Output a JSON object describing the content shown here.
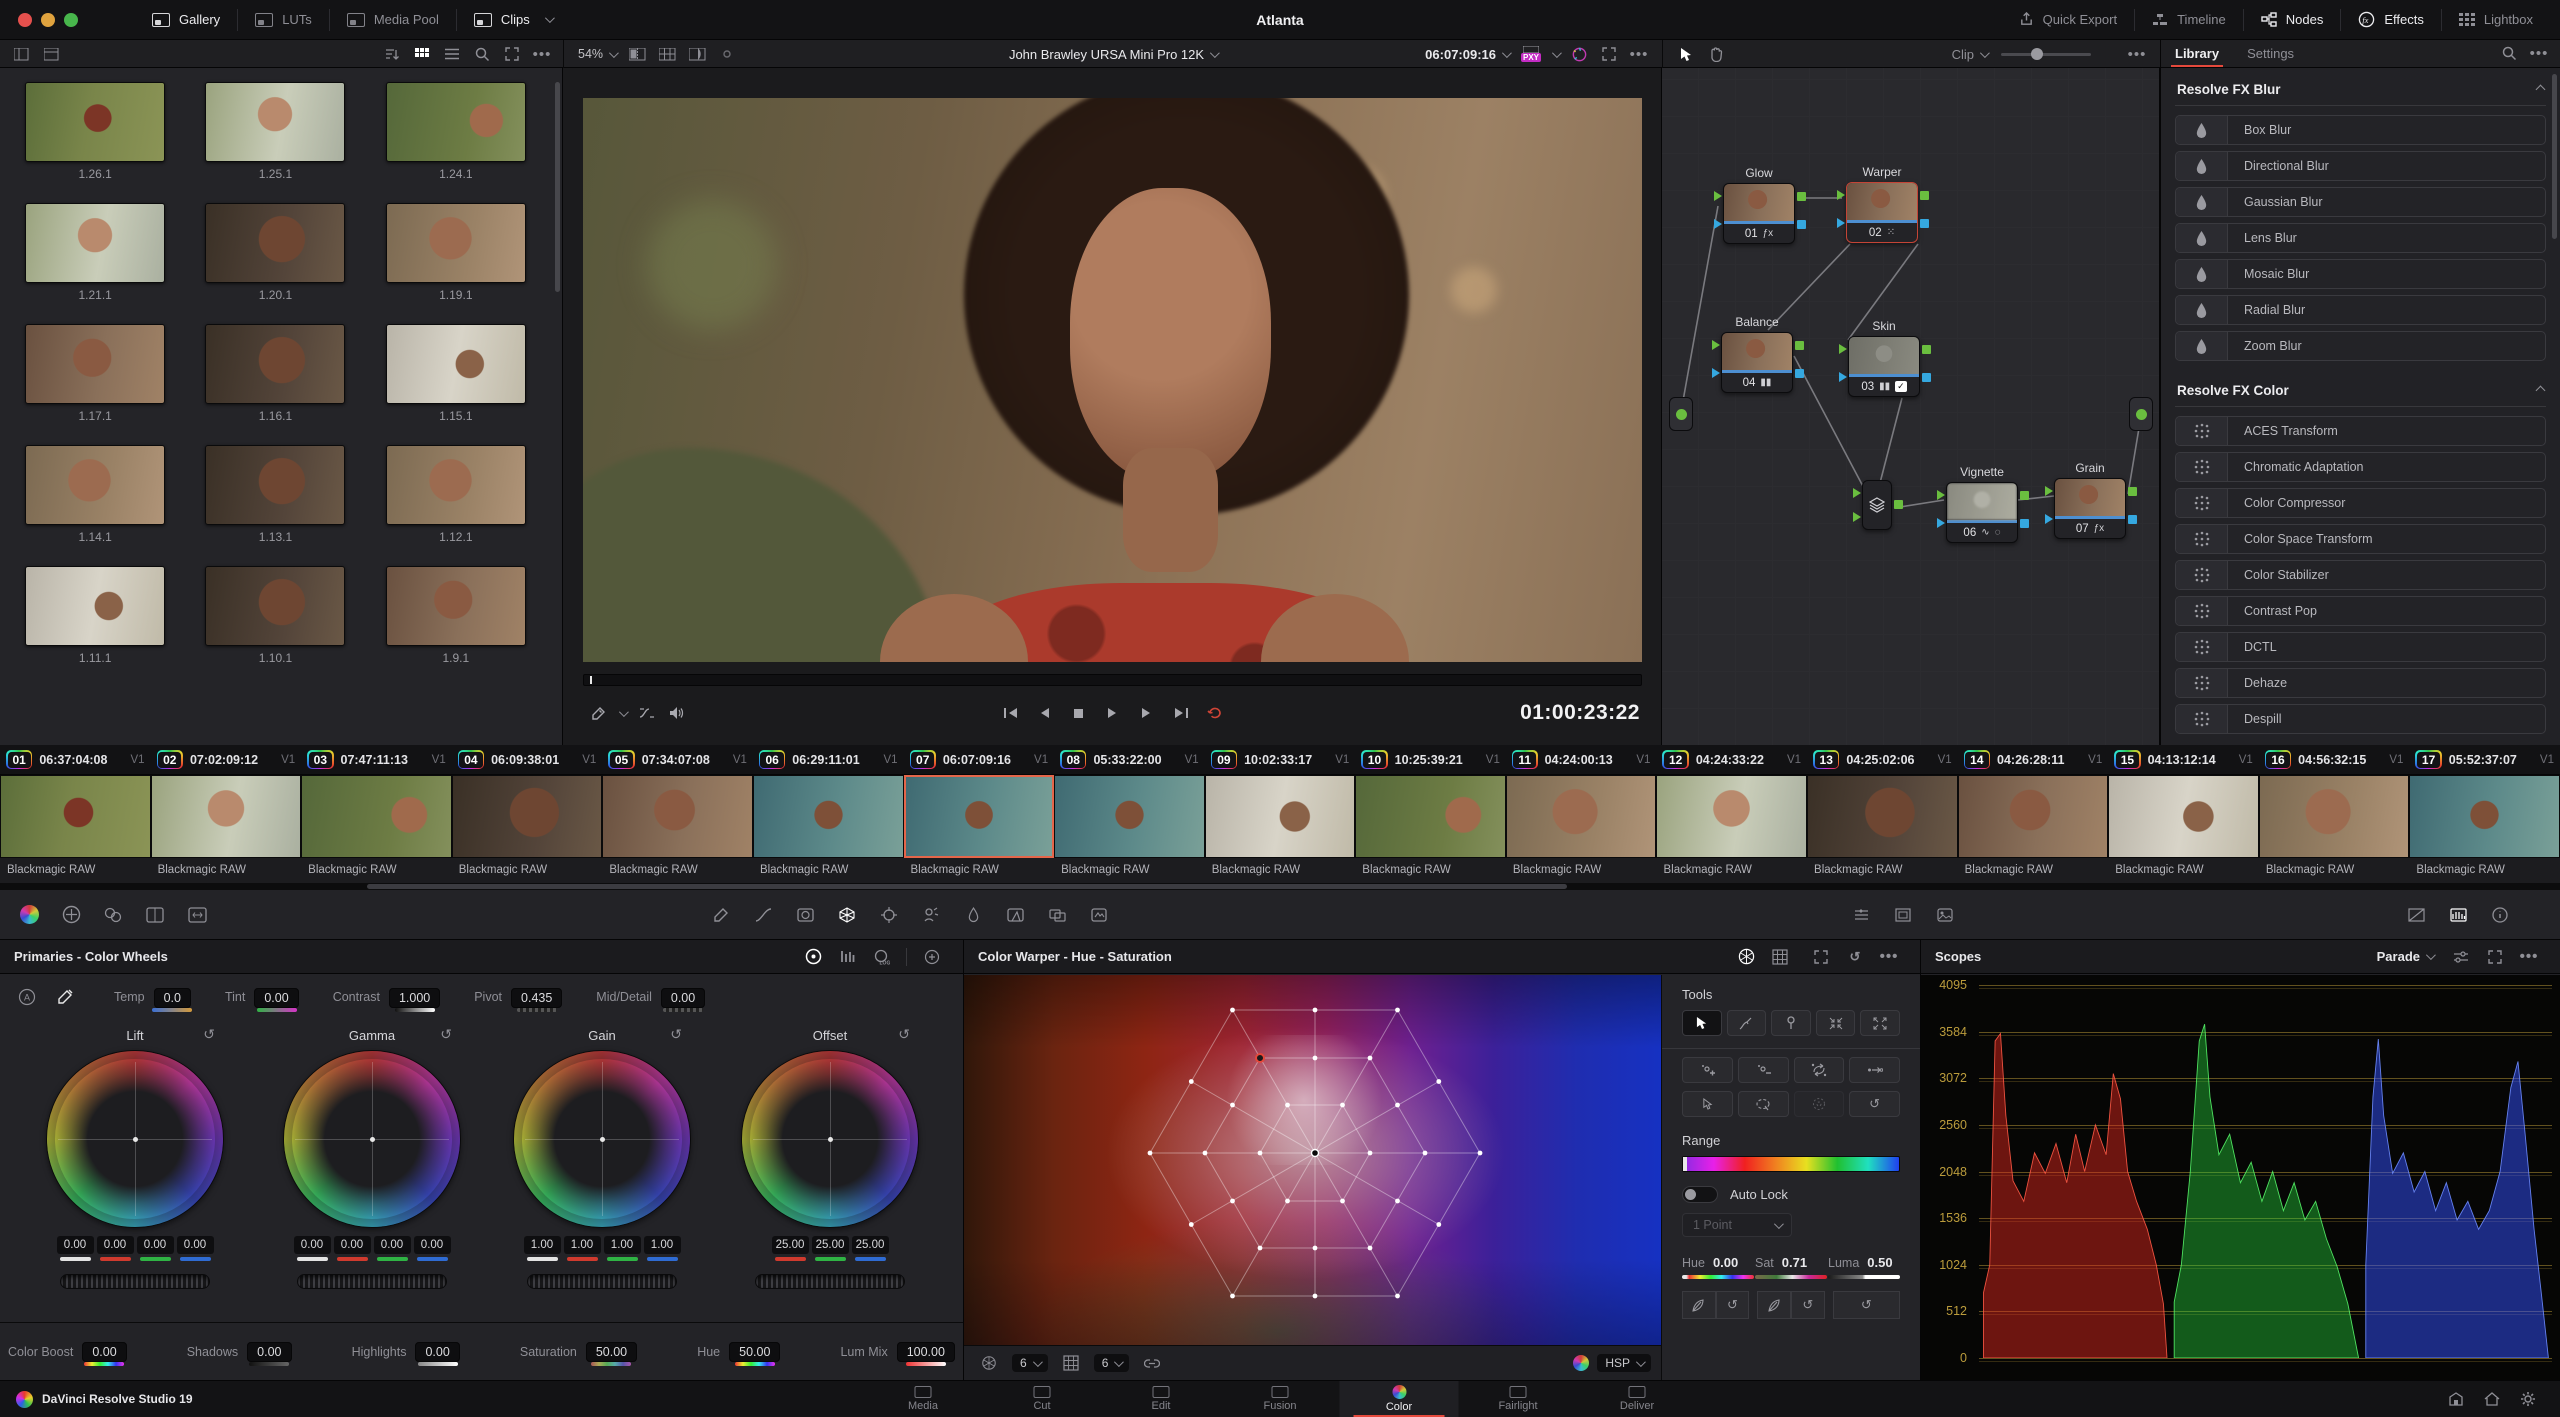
{
  "titlebar": {
    "title": "Atlanta",
    "left": [
      {
        "label": "Gallery",
        "active": true
      },
      {
        "label": "LUTs",
        "active": false
      },
      {
        "label": "Media Pool",
        "active": false
      },
      {
        "label": "Clips",
        "active": true,
        "dropdown": true
      }
    ],
    "right": [
      {
        "label": "Quick Export",
        "active": false
      },
      {
        "label": "Timeline",
        "active": false
      },
      {
        "label": "Nodes",
        "active": true
      },
      {
        "label": "Effects",
        "active": true
      },
      {
        "label": "Lightbox",
        "active": false
      }
    ]
  },
  "gallery": {
    "zoom_level": "54%",
    "stills": [
      "1.26.1",
      "1.25.1",
      "1.24.1",
      "1.21.1",
      "1.20.1",
      "1.19.1",
      "1.17.1",
      "1.16.1",
      "1.15.1",
      "1.14.1",
      "1.13.1",
      "1.12.1",
      "1.11.1",
      "1.10.1",
      "1.9.1"
    ]
  },
  "viewer": {
    "clip_title": "John Brawley URSA Mini Pro 12K",
    "timecode": "06:07:09:16",
    "proxy_badge": "PXY",
    "play_timecode": "01:00:23:22"
  },
  "node_panel": {
    "mode_label": "Clip",
    "nodes": {
      "glow": {
        "num": "01",
        "label": "Glow"
      },
      "warper": {
        "num": "02",
        "label": "Warper"
      },
      "balance": {
        "num": "04",
        "label": "Balance"
      },
      "skin": {
        "num": "03",
        "label": "Skin"
      },
      "vignette": {
        "num": "06",
        "label": "Vignette"
      },
      "grain": {
        "num": "07",
        "label": "Grain"
      }
    }
  },
  "library": {
    "tabs": [
      {
        "label": "Library",
        "active": true
      },
      {
        "label": "Settings",
        "active": false
      }
    ],
    "sections": [
      {
        "title": "Resolve FX Blur",
        "items": [
          "Box Blur",
          "Directional Blur",
          "Gaussian Blur",
          "Lens Blur",
          "Mosaic Blur",
          "Radial Blur",
          "Zoom Blur"
        ]
      },
      {
        "title": "Resolve FX Color",
        "items": [
          "ACES Transform",
          "Chromatic Adaptation",
          "Color Compressor",
          "Color Space Transform",
          "Color Stabilizer",
          "Contrast Pop",
          "DCTL",
          "Dehaze",
          "Despill"
        ]
      }
    ]
  },
  "timeline": {
    "clips": [
      {
        "num": "01",
        "timecode": "06:37:04:08",
        "track": "V1",
        "codec": "Blackmagic RAW",
        "selected": false
      },
      {
        "num": "02",
        "timecode": "07:02:09:12",
        "track": "V1",
        "codec": "Blackmagic RAW",
        "selected": false
      },
      {
        "num": "03",
        "timecode": "07:47:11:13",
        "track": "V1",
        "codec": "Blackmagic RAW",
        "selected": false
      },
      {
        "num": "04",
        "timecode": "06:09:38:01",
        "track": "V1",
        "codec": "Blackmagic RAW",
        "selected": false
      },
      {
        "num": "05",
        "timecode": "07:34:07:08",
        "track": "V1",
        "codec": "Blackmagic RAW",
        "selected": false
      },
      {
        "num": "06",
        "timecode": "06:29:11:01",
        "track": "V1",
        "codec": "Blackmagic RAW",
        "selected": false
      },
      {
        "num": "07",
        "timecode": "06:07:09:16",
        "track": "V1",
        "codec": "Blackmagic RAW",
        "selected": true
      },
      {
        "num": "08",
        "timecode": "05:33:22:00",
        "track": "V1",
        "codec": "Blackmagic RAW",
        "selected": false
      },
      {
        "num": "09",
        "timecode": "10:02:33:17",
        "track": "V1",
        "codec": "Blackmagic RAW",
        "selected": false
      },
      {
        "num": "10",
        "timecode": "10:25:39:21",
        "track": "V1",
        "codec": "Blackmagic RAW",
        "selected": false
      },
      {
        "num": "11",
        "timecode": "04:24:00:13",
        "track": "V1",
        "codec": "Blackmagic RAW",
        "selected": false
      },
      {
        "num": "12",
        "timecode": "04:24:33:22",
        "track": "V1",
        "codec": "Blackmagic RAW",
        "selected": false
      },
      {
        "num": "13",
        "timecode": "04:25:02:06",
        "track": "V1",
        "codec": "Blackmagic RAW",
        "selected": false
      },
      {
        "num": "14",
        "timecode": "04:26:28:11",
        "track": "V1",
        "codec": "Blackmagic RAW",
        "selected": false
      },
      {
        "num": "15",
        "timecode": "04:13:12:14",
        "track": "V1",
        "codec": "Blackmagic RAW",
        "selected": false
      },
      {
        "num": "16",
        "timecode": "04:56:32:15",
        "track": "V1",
        "codec": "Blackmagic RAW",
        "selected": false
      },
      {
        "num": "17",
        "timecode": "05:52:37:07",
        "track": "V1",
        "codec": "Blackmagic RAW",
        "selected": false
      }
    ]
  },
  "primaries": {
    "title": "Primaries - Color Wheels",
    "params": [
      {
        "label": "Temp",
        "value": "0.0"
      },
      {
        "label": "Tint",
        "value": "0.00"
      },
      {
        "label": "Contrast",
        "value": "1.000"
      },
      {
        "label": "Pivot",
        "value": "0.435"
      },
      {
        "label": "Mid/Detail",
        "value": "0.00"
      }
    ],
    "wheels": [
      {
        "name": "Lift",
        "values": [
          "0.00",
          "0.00",
          "0.00",
          "0.00"
        ]
      },
      {
        "name": "Gamma",
        "values": [
          "0.00",
          "0.00",
          "0.00",
          "0.00"
        ]
      },
      {
        "name": "Gain",
        "values": [
          "1.00",
          "1.00",
          "1.00",
          "1.00"
        ]
      },
      {
        "name": "Offset",
        "values": [
          "25.00",
          "25.00",
          "25.00"
        ]
      }
    ],
    "footer": [
      {
        "label": "Color Boost",
        "value": "0.00"
      },
      {
        "label": "Shadows",
        "value": "0.00"
      },
      {
        "label": "Highlights",
        "value": "0.00"
      },
      {
        "label": "Saturation",
        "value": "50.00"
      },
      {
        "label": "Hue",
        "value": "50.00"
      },
      {
        "label": "Lum Mix",
        "value": "100.00"
      }
    ]
  },
  "warper": {
    "title": "Color Warper - Hue - Saturation",
    "tools_label": "Tools",
    "range_label": "Range",
    "auto_lock_label": "Auto Lock",
    "point_mode": "1 Point",
    "params": [
      {
        "label": "Hue",
        "value": "0.00"
      },
      {
        "label": "Sat",
        "value": "0.71"
      },
      {
        "label": "Luma",
        "value": "0.50"
      }
    ],
    "grid_rows": "6",
    "grid_cols": "6",
    "color_mode": "HSP"
  },
  "scopes": {
    "title": "Scopes",
    "mode": "Parade",
    "ticks": [
      "4095",
      "3584",
      "3072",
      "2560",
      "2048",
      "1536",
      "1024",
      "512",
      "0"
    ]
  },
  "navbar": {
    "app_name": "DaVinci Resolve Studio 19",
    "pages": [
      {
        "label": "Media",
        "active": false
      },
      {
        "label": "Cut",
        "active": false
      },
      {
        "label": "Edit",
        "active": false
      },
      {
        "label": "Fusion",
        "active": false
      },
      {
        "label": "Color",
        "active": true
      },
      {
        "label": "Fairlight",
        "active": false
      },
      {
        "label": "Deliver",
        "active": false
      }
    ]
  }
}
